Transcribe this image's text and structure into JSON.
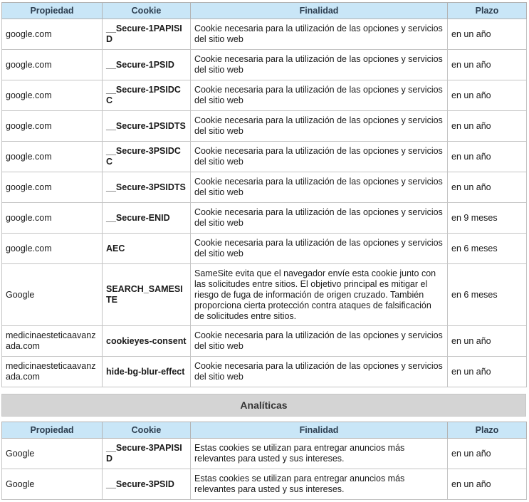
{
  "headers": [
    "Propiedad",
    "Cookie",
    "Finalidad",
    "Plazo"
  ],
  "necessary_rows": [
    {
      "property": "google.com",
      "cookie": "__Secure-1PAPISID",
      "purpose": "Cookie necesaria para la utilización de las opciones y servicios del sitio web",
      "term": "en un año"
    },
    {
      "property": "google.com",
      "cookie": "__Secure-1PSID",
      "purpose": "Cookie necesaria para la utilización de las opciones y servicios del sitio web",
      "term": "en un año"
    },
    {
      "property": "google.com",
      "cookie": "__Secure-1PSIDCC",
      "purpose": "Cookie necesaria para la utilización de las opciones y servicios del sitio web",
      "term": "en un año"
    },
    {
      "property": "google.com",
      "cookie": "__Secure-1PSIDTS",
      "purpose": "Cookie necesaria para la utilización de las opciones y servicios del sitio web",
      "term": "en un año"
    },
    {
      "property": "google.com",
      "cookie": "__Secure-3PSIDCC",
      "purpose": "Cookie necesaria para la utilización de las opciones y servicios del sitio web",
      "term": "en un año"
    },
    {
      "property": "google.com",
      "cookie": "__Secure-3PSIDTS",
      "purpose": "Cookie necesaria para la utilización de las opciones y servicios del sitio web",
      "term": "en un año"
    },
    {
      "property": "google.com",
      "cookie": "__Secure-ENID",
      "purpose": "Cookie necesaria para la utilización de las opciones y servicios del sitio web",
      "term": "en 9 meses"
    },
    {
      "property": "google.com",
      "cookie": "AEC",
      "purpose": "Cookie necesaria para la utilización de las opciones y servicios del sitio web",
      "term": "en 6 meses"
    },
    {
      "property": "Google",
      "cookie": "SEARCH_SAMESITE",
      "purpose": "SameSite evita que el navegador envíe esta cookie junto con las solicitudes entre sitios. El objetivo principal es mitigar el riesgo de fuga de información de origen cruzado. También proporciona cierta protección contra ataques de falsificación de solicitudes entre sitios.",
      "term": "en 6 meses"
    },
    {
      "property": "medicinaesteticaavanzada.com",
      "cookie": "cookieyes-consent",
      "purpose": "Cookie necesaria para la utilización de las opciones y servicios del sitio web",
      "term": "en un año"
    },
    {
      "property": "medicinaesteticaavanzada.com",
      "cookie": "hide-bg-blur-effect",
      "purpose": "Cookie necesaria para la utilización de las opciones y servicios del sitio web",
      "term": "en un año"
    }
  ],
  "analytics_section_title": "Analíticas",
  "analytics_rows": [
    {
      "property": "Google",
      "cookie": "__Secure-3PAPISID",
      "purpose": "Estas cookies se utilizan para entregar anuncios más relevantes para usted y sus intereses.",
      "term": "en un año"
    },
    {
      "property": "Google",
      "cookie": "__Secure-3PSID",
      "purpose": "Estas cookies se utilizan para entregar anuncios más relevantes para usted y sus intereses.",
      "term": "en un año"
    }
  ]
}
